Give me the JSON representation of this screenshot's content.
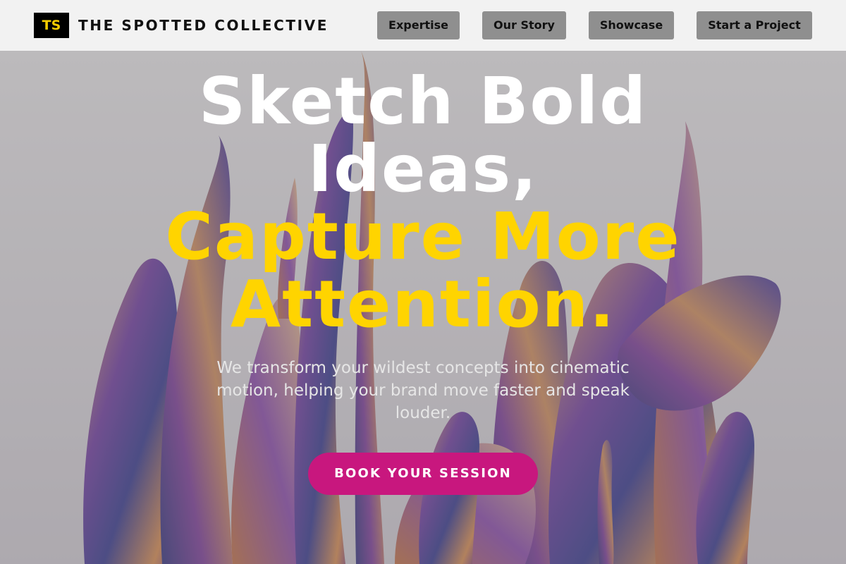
{
  "brand": {
    "mark": "TS",
    "name": "THE SPOTTED COLLECTIVE"
  },
  "nav": {
    "items": [
      {
        "label": "Expertise"
      },
      {
        "label": "Our Story"
      },
      {
        "label": "Showcase"
      },
      {
        "label": "Start a Project"
      }
    ]
  },
  "hero": {
    "headline_white": [
      "Sketch Bold",
      "Ideas,"
    ],
    "headline_gold": [
      "Capture More",
      "Attention."
    ],
    "subtext": "We transform your wildest concepts into cinematic motion, helping your brand move faster and speak louder.",
    "cta_label": "BOOK YOUR SESSION",
    "background_icon": "abstract-liquid-sculpture-image"
  },
  "colors": {
    "header_bg": "#f2f2f2",
    "nav_button_bg": "#8f8f8f",
    "accent_gold": "#ffd400",
    "cta_magenta": "#c8177e",
    "logo_bg": "#000000"
  }
}
